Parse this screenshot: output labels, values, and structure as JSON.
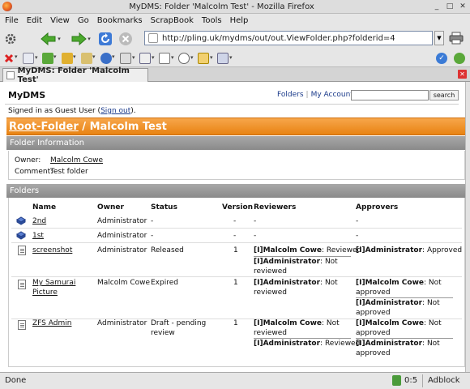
{
  "window": {
    "title": "MyDMS: Folder 'Malcolm Test' - Mozilla Firefox",
    "controls": [
      "_",
      "□",
      "✕"
    ]
  },
  "menubar": {
    "items": [
      {
        "label": "File"
      },
      {
        "label": "Edit"
      },
      {
        "label": "View"
      },
      {
        "label": "Go"
      },
      {
        "label": "Bookmarks"
      },
      {
        "label": "ScrapBook"
      },
      {
        "label": "Tools"
      },
      {
        "label": "Help"
      }
    ]
  },
  "navbar": {
    "url": "http://pling.uk/mydms/out/out.ViewFolder.php?folderid=4"
  },
  "tabs": [
    {
      "label": "MyDMS: Folder 'Malcolm Test'"
    }
  ],
  "page": {
    "brand": "MyDMS",
    "header_links": {
      "folders": "Folders",
      "separator": "|",
      "my_account": "My Account"
    },
    "search_button": "search",
    "signed_in": {
      "prefix": "Signed in as Guest User (",
      "link": "Sign out",
      "suffix": ")."
    },
    "breadcrumb": {
      "root": "Root-Folder",
      "separator": " / ",
      "current": "Malcolm Test"
    },
    "folder_info": {
      "heading": "Folder Information",
      "owner_label": "Owner:",
      "owner_value": "Malcolm Cowe",
      "comment_label": "Comment:",
      "comment_value": "Test folder"
    },
    "folders": {
      "heading": "Folders",
      "columns": {
        "name": "Name",
        "owner": "Owner",
        "status": "Status",
        "version": "Version",
        "reviewers": "Reviewers",
        "approvers": "Approvers"
      },
      "rows": [
        {
          "name": "2nd",
          "owner": "Administrator",
          "status": "-",
          "version": "-",
          "reviewers": "-",
          "approvers": "-"
        },
        {
          "name": "1st",
          "owner": "Administrator",
          "status": "-",
          "version": "-",
          "reviewers": "-",
          "approvers": "-"
        },
        {
          "name": "screenshot",
          "owner": "Administrator",
          "status": "Released",
          "version": "1",
          "rev1_user": "[I]Malcolm Cowe",
          "rev1_status": ": Reviewed",
          "rev2_user": "[I]Administrator",
          "rev2_status": ": Not",
          "rev2_status2": "reviewed",
          "app1_user": "[I]Administrator",
          "app1_status": ": Approved"
        },
        {
          "name": "My Samurai",
          "name2": "Picture",
          "owner": "Malcolm Cowe",
          "status": "Expired",
          "version": "1",
          "rev1_user": "[I]Administrator",
          "rev1_status": ": Not",
          "rev1_status2": "reviewed",
          "app1_user": "[I]Malcolm Cowe",
          "app1_status": ": Not",
          "app1_status2": "approved",
          "app2_user": "[I]Administrator",
          "app2_status": ": Not",
          "app2_status2": "approved"
        },
        {
          "name": "ZFS Admin",
          "owner": "Administrator",
          "status": "Draft - pending",
          "status2": "review",
          "version": "1",
          "rev1_user": "[I]Malcolm Cowe",
          "rev1_status": ": Not",
          "rev1_status2": "reviewed",
          "rev2_user": "[I]Administrator",
          "rev2_status": ": Reviewed",
          "app1_user": "[I]Malcolm Cowe",
          "app1_status": ": Not",
          "app1_status2": "approved",
          "app2_user": "[I]Administrator",
          "app2_status": ": Not",
          "app2_status2": "approved"
        }
      ]
    }
  },
  "statusbar": {
    "text": "Done",
    "count": "0:5",
    "adblock": "Adblock"
  }
}
